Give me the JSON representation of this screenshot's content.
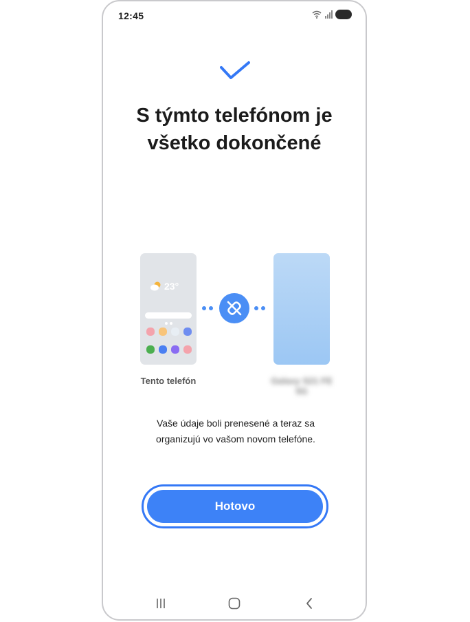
{
  "status_bar": {
    "time": "12:45",
    "icons": [
      "wifi-icon",
      "signal-icon",
      "battery-icon"
    ]
  },
  "header": {
    "icon": "checkmark-icon",
    "title_line1": "S týmto telefónom je",
    "title_line2": "všetko dokončené"
  },
  "illustration": {
    "this_phone": {
      "label": "Tento telefón",
      "weather_temp": "23°",
      "app_colors": [
        "#f4a3ac",
        "#f8c47a",
        "#e8eef4",
        "#6f8df0",
        "#4caf50",
        "#4a7ff2",
        "#8a6cf2",
        "#f4a3ac"
      ]
    },
    "link_icon": "broken-link-icon",
    "other_phone": {
      "label": "Galaxy S21 FE 5G"
    },
    "colors": {
      "accent": "#4a8ef5",
      "this_phone_bg": "#e1e4e8",
      "other_phone_bg": "#a8cff5"
    }
  },
  "message": {
    "line1": "Vaše údaje boli prenesené a teraz sa",
    "line2": "organizujú vo vašom novom telefóne."
  },
  "actions": {
    "done_label": "Hotovo",
    "button_color": "#3d82f7"
  },
  "navigation": {
    "recents": "recents-icon",
    "home": "home-icon",
    "back": "back-icon"
  }
}
